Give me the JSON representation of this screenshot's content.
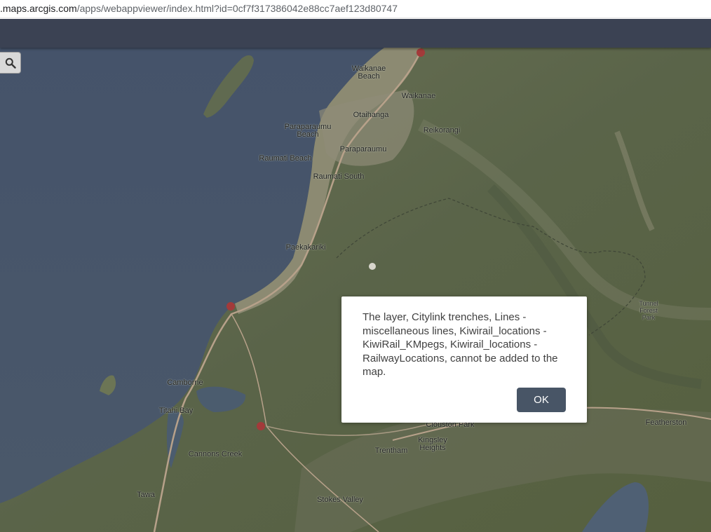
{
  "browser": {
    "url_prefix": ".maps.arcgis.com",
    "url_path": "/apps/webappviewer/index.html?id=0cf7f317386042e88cc7aef123d80747"
  },
  "map": {
    "places": [
      {
        "name": "Waikanae\nBeach"
      },
      {
        "name": "Waikanae"
      },
      {
        "name": "Otaihanga"
      },
      {
        "name": "Paraparaumu\nBeach"
      },
      {
        "name": "Reikorangi"
      },
      {
        "name": "Paraparaumu"
      },
      {
        "name": "Raumati Beach"
      },
      {
        "name": "Raumati South"
      },
      {
        "name": "Paekakariki"
      },
      {
        "name": "Tunnel\nForest Park"
      },
      {
        "name": "Camborne"
      },
      {
        "name": "Titahi Bay"
      },
      {
        "name": "Clouston Park"
      },
      {
        "name": "Kingsley\nHeights"
      },
      {
        "name": "Featherston"
      },
      {
        "name": "Trentham"
      },
      {
        "name": "Cannons Creek"
      },
      {
        "name": "Tawa"
      },
      {
        "name": "Stokes Valley"
      }
    ]
  },
  "dialog": {
    "message": "The layer, Citylink trenches, Lines - miscellaneous lines, Kiwirail_locations - KiwiRail_KMpegs, Kiwirail_locations - RailwayLocations, cannot be added to the map.",
    "ok_label": "OK"
  }
}
